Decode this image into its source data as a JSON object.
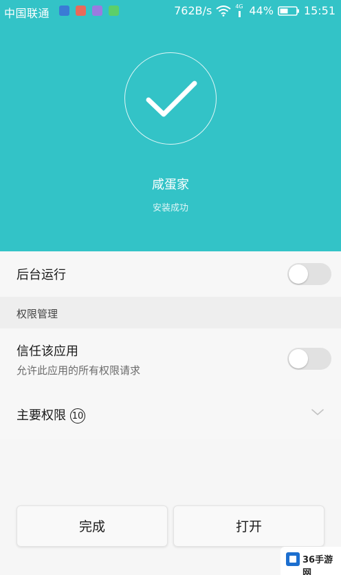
{
  "status_bar": {
    "carrier": "中国联通",
    "notification_icons": [
      {
        "name": "browser-notification-icon",
        "color": "#3a7bd5"
      },
      {
        "name": "app-notification-icon",
        "color": "#e86a5a"
      },
      {
        "name": "message-notification-icon",
        "color": "#9a7be0"
      },
      {
        "name": "phone-notification-icon",
        "color": "#5ccf6a"
      }
    ],
    "net_speed": "762B/s",
    "signal_type": "4G",
    "battery_percent": "44%",
    "time": "15:51"
  },
  "header": {
    "background_color": "#33c3c7",
    "app_name": "咸蛋家",
    "install_status": "安装成功"
  },
  "settings": {
    "background_run_label": "后台运行",
    "background_run_enabled": false,
    "permission_section_title": "权限管理",
    "trust_app_label": "信任该应用",
    "trust_app_sub": "允许此应用的所有权限请求",
    "trust_app_enabled": false,
    "main_permissions_label": "主要权限",
    "main_permissions_count": "10"
  },
  "buttons": {
    "done_label": "完成",
    "open_label": "打开"
  },
  "watermark": {
    "brand": "36手游网"
  }
}
